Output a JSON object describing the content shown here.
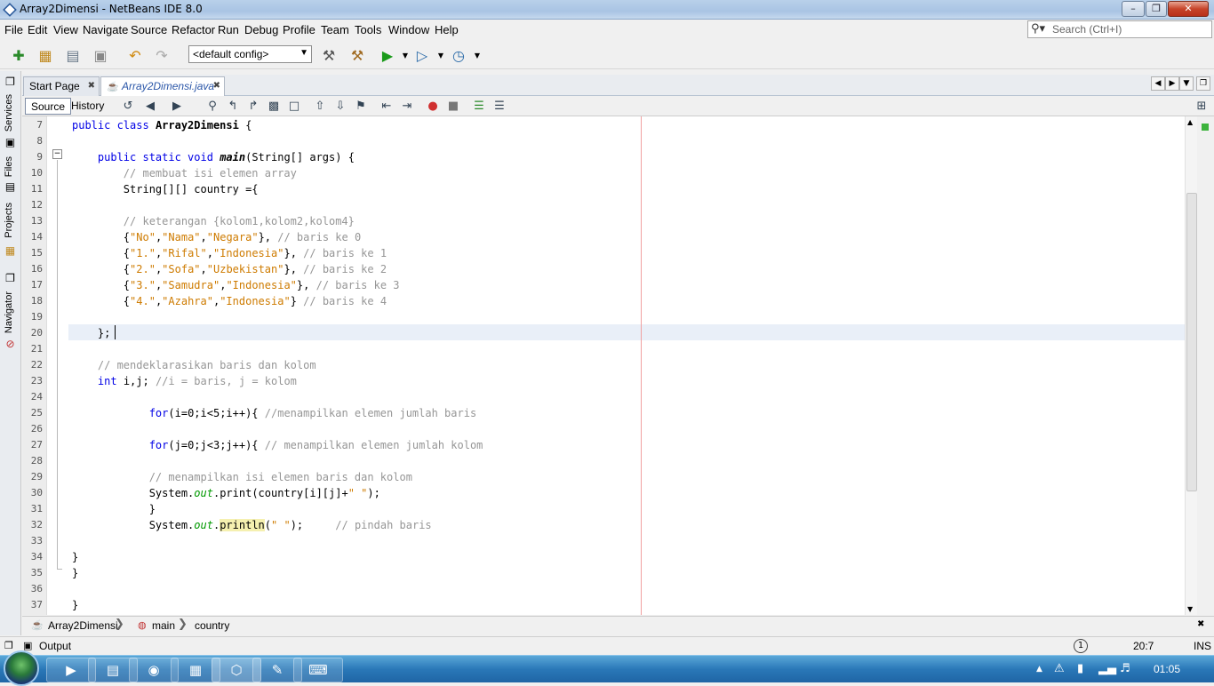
{
  "window": {
    "title": "Array2Dimensi - NetBeans IDE 8.0"
  },
  "menu": [
    "File",
    "Edit",
    "View",
    "Navigate",
    "Source",
    "Refactor",
    "Run",
    "Debug",
    "Profile",
    "Team",
    "Tools",
    "Window",
    "Help"
  ],
  "search": {
    "placeholder": "Search (Ctrl+I)"
  },
  "toolbar": {
    "config": "<default config>"
  },
  "side_tabs": [
    "Services",
    "Files",
    "Projects",
    "Navigator"
  ],
  "tabs": [
    {
      "label": "Start Page",
      "active": false
    },
    {
      "label": "Array2Dimensi.java",
      "active": true
    }
  ],
  "editor_toolbar": {
    "source": "Source",
    "history": "History"
  },
  "lines": [
    {
      "n": "7",
      "html": "<span class=\"kw\">public class</span> <span class=\"b\">Array2Dimensi</span> {"
    },
    {
      "n": "8",
      "html": ""
    },
    {
      "n": "9",
      "html": "    <span class=\"kw\">public static void</span> <span class=\"b\" style=\"font-style:italic\">main</span>(String[] args) {"
    },
    {
      "n": "10",
      "html": "        <span class=\"cm\">// membuat isi elemen array</span>"
    },
    {
      "n": "11",
      "html": "        String[][] country ={"
    },
    {
      "n": "12",
      "html": ""
    },
    {
      "n": "13",
      "html": "        <span class=\"cm\">// keterangan {kolom1,kolom2,kolom4}</span>"
    },
    {
      "n": "14",
      "html": "        {<span class=\"st\">\"No\"</span>,<span class=\"st\">\"Nama\"</span>,<span class=\"st\">\"Negara\"</span>}, <span class=\"cm\">// baris ke 0</span>"
    },
    {
      "n": "15",
      "html": "        {<span class=\"st\">\"1.\"</span>,<span class=\"st\">\"Rifal\"</span>,<span class=\"st\">\"Indonesia\"</span>}, <span class=\"cm\">// baris ke 1</span>"
    },
    {
      "n": "16",
      "html": "        {<span class=\"st\">\"2.\"</span>,<span class=\"st\">\"Sofa\"</span>,<span class=\"st\">\"Uzbekistan\"</span>}, <span class=\"cm\">// baris ke 2</span>"
    },
    {
      "n": "17",
      "html": "        {<span class=\"st\">\"3.\"</span>,<span class=\"st\">\"Samudra\"</span>,<span class=\"st\">\"Indonesia\"</span>}, <span class=\"cm\">// baris ke 3</span>"
    },
    {
      "n": "18",
      "html": "        {<span class=\"st\">\"4.\"</span>,<span class=\"st\">\"Azahra\"</span>,<span class=\"st\">\"Indonesia\"</span>} <span class=\"cm\">// baris ke 4</span>"
    },
    {
      "n": "19",
      "html": ""
    },
    {
      "n": "20",
      "html": "    };"
    },
    {
      "n": "21",
      "html": ""
    },
    {
      "n": "22",
      "html": "    <span class=\"cm\">// mendeklarasikan baris dan kolom</span>"
    },
    {
      "n": "23",
      "html": "    <span class=\"kw\">int</span> i,j; <span class=\"cm\">//i = baris, j = kolom</span>"
    },
    {
      "n": "24",
      "html": ""
    },
    {
      "n": "25",
      "html": "            <span class=\"kw\">for</span>(i=0;i&lt;5;i++){ <span class=\"cm\">//menampilkan elemen jumlah baris</span>"
    },
    {
      "n": "26",
      "html": ""
    },
    {
      "n": "27",
      "html": "            <span class=\"kw\">for</span>(j=0;j&lt;3;j++){ <span class=\"cm\">// menampilkan elemen jumlah kolom</span>"
    },
    {
      "n": "28",
      "html": ""
    },
    {
      "n": "29",
      "html": "            <span class=\"cm\">// menampilkan isi elemen baris dan kolom</span>"
    },
    {
      "n": "30",
      "html": "            System.<span class=\"fi\">out</span>.print(country[i][j]+<span class=\"st\">\" \"</span>);"
    },
    {
      "n": "31",
      "html": "            }"
    },
    {
      "n": "32",
      "html": "            System.<span class=\"fi\">out</span>.<span style=\"background:#f5f0b0\">println</span>(<span class=\"st\">\" \"</span>);     <span class=\"cm\">// pindah baris</span>"
    },
    {
      "n": "33",
      "html": ""
    },
    {
      "n": "34",
      "html": "}"
    },
    {
      "n": "35",
      "html": "}"
    },
    {
      "n": "36",
      "html": ""
    },
    {
      "n": "37",
      "html": "}"
    }
  ],
  "breadcrumb": [
    "Array2Dimensi",
    "main",
    "country"
  ],
  "output": {
    "label": "Output",
    "position": "20:7",
    "mode": "INS",
    "notifications": "1"
  },
  "taskbar": {
    "clock": "01:05"
  }
}
